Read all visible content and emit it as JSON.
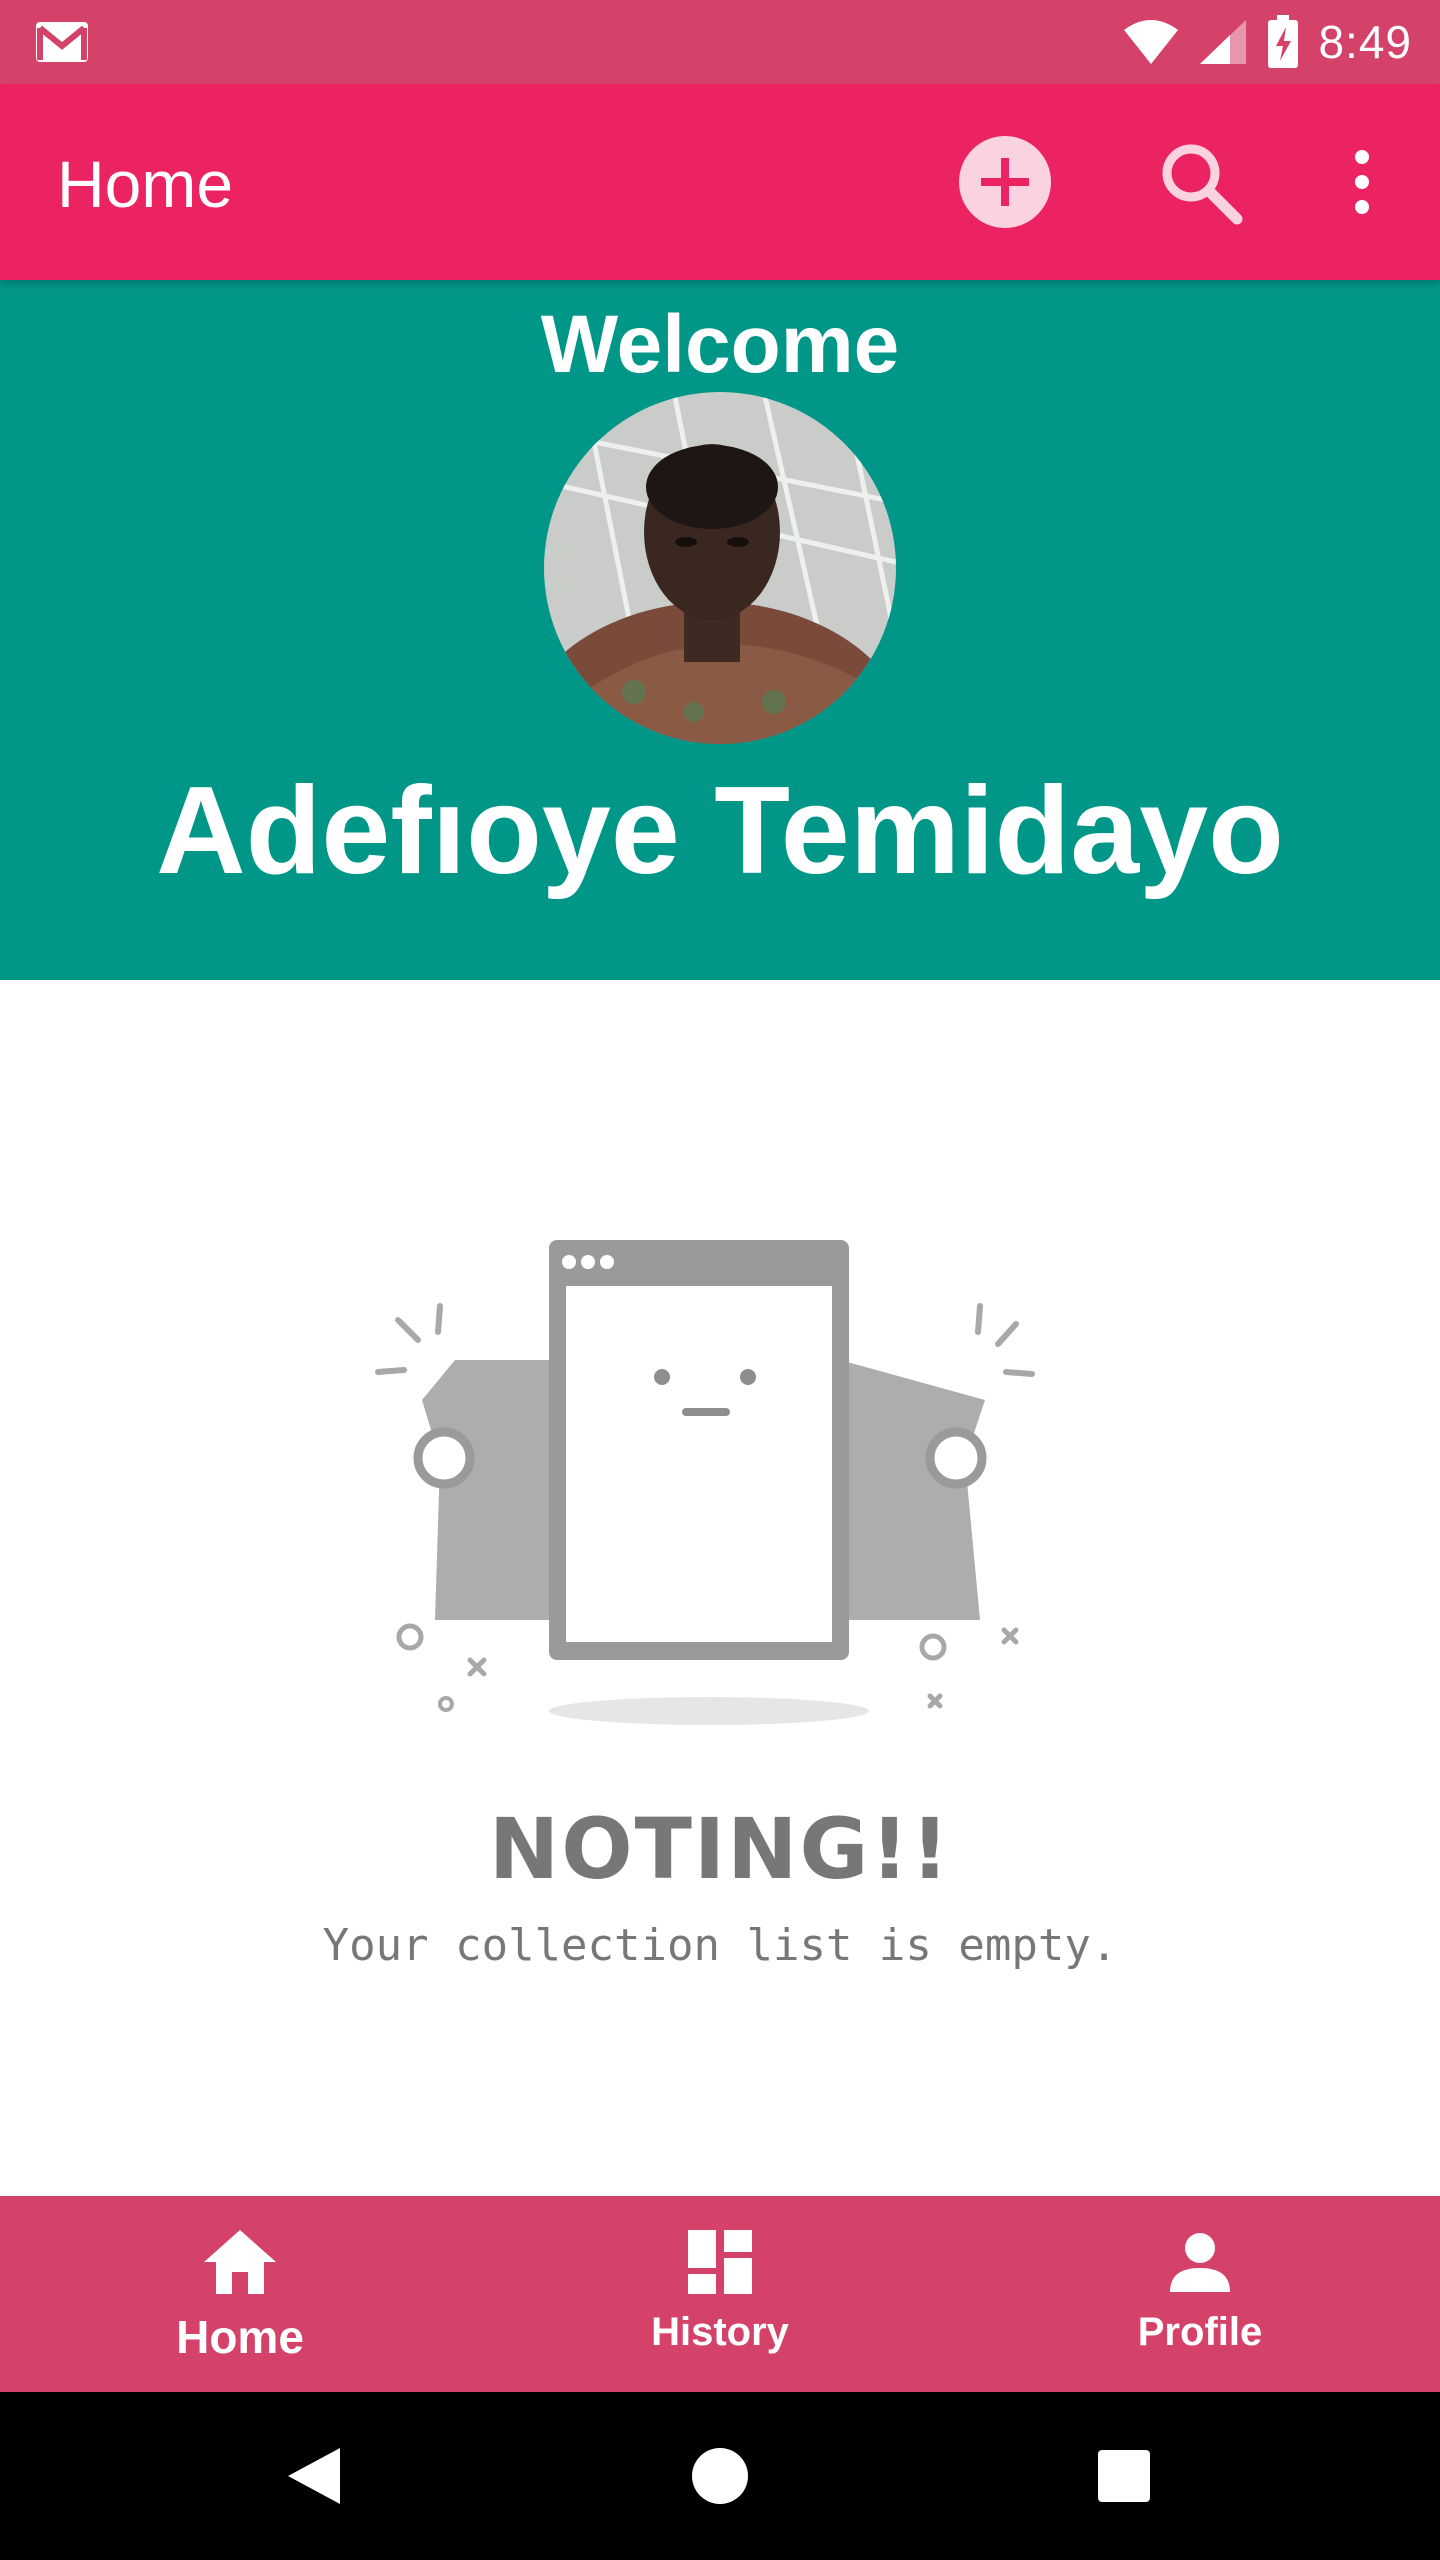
{
  "status_bar": {
    "time": "8:49"
  },
  "app_bar": {
    "title": "Home"
  },
  "header": {
    "welcome": "Welcome",
    "user_name": "Adefıoye Temidayo"
  },
  "empty_state": {
    "title": "NOTING!!",
    "message": "Your collection list is empty."
  },
  "bottom_nav": {
    "items": [
      {
        "label": "Home",
        "icon": "home-icon",
        "active": true
      },
      {
        "label": "History",
        "icon": "dashboard-icon",
        "active": false
      },
      {
        "label": "Profile",
        "icon": "person-icon",
        "active": false
      }
    ]
  },
  "colors": {
    "status_bar": "#d4426a",
    "app_bar": "#ec2363",
    "header": "#009688",
    "bottom_nav": "#d4426a"
  }
}
